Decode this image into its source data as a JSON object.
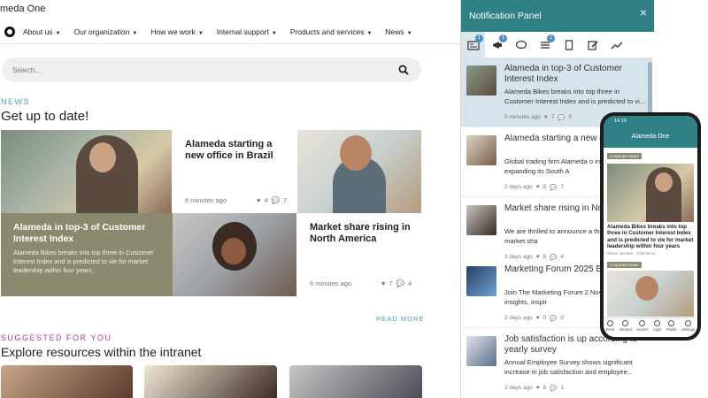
{
  "site": {
    "name": "meda One"
  },
  "nav": {
    "items": [
      "About us",
      "Our organization",
      "How we work",
      "Internal support",
      "Products and services",
      "News"
    ]
  },
  "search": {
    "placeholder": "Search..."
  },
  "news": {
    "eyebrow": "NEWS",
    "title": "Get up to date!",
    "cards": [
      {
        "title": "Alameda starting a new office in Brazil",
        "time": "6 minutes ago",
        "likes": "4",
        "comments": "7"
      },
      {
        "title": "Alameda in top-3 of Customer Interest Index",
        "body": "Alameda Bikes breaks into top three in Customer Interest Index and is predicted to vie for market leadership within four years."
      },
      {
        "title": "Market share rising in North America",
        "time": "6 minutes ago",
        "likes": "7",
        "comments": "4"
      }
    ],
    "read_more": "READ MORE"
  },
  "suggested": {
    "eyebrow": "SUGGESTED FOR YOU",
    "title": "Explore resources within the intranet"
  },
  "panel": {
    "title": "Notification Panel",
    "close": "×",
    "tabs": [
      {
        "icon": "news-icon",
        "badge": "1",
        "active": true
      },
      {
        "icon": "megaphone-icon",
        "badge": "1"
      },
      {
        "icon": "chat-icon"
      },
      {
        "icon": "tasks-icon",
        "badge": "1"
      },
      {
        "icon": "document-icon"
      },
      {
        "icon": "edit-icon"
      },
      {
        "icon": "chart-icon"
      }
    ],
    "items": [
      {
        "title": "Alameda in top-3 of Customer Interest Index",
        "body": "Alameda Bikes breaks into top three in Customer Interest Index and is predicted to vi...",
        "time": "5 minutes ago",
        "likes": "7",
        "comments": "5"
      },
      {
        "title": "Alameda starting a new o Brazil",
        "body": "Global trading firm Alameda o in Brazil, expanding its South A",
        "time": "2 days ago",
        "likes": "5",
        "comments": "7"
      },
      {
        "title": "Market share rising in No",
        "body": "We are thrilled to announce a the North America market sha",
        "time": "3 days ago",
        "likes": "8",
        "comments": "4"
      },
      {
        "title": "Marketing Forum 2025 Berlin",
        "body": "Join The Marketing Forum 2 Nov 12-13 for insights, inspir",
        "time": "2 days ago",
        "likes": "0",
        "comments": "0"
      },
      {
        "title": "Job satisfaction is up according to yearly survey",
        "body": "Annual Employee Survey shows significant increase in job satisfaction and employee...",
        "time": "2 days ago",
        "likes": "6",
        "comments": "1"
      }
    ]
  },
  "phone": {
    "time": "14:16",
    "title": "Alameda One",
    "tag1": "Corporate News",
    "headline": "Alameda Bikes breaks into top three in Customer Interest Index and is predicted to vie for market leadership within four years",
    "meta": "Robert Jenssen · 2025-09-24",
    "tag2": "Corporate News",
    "tabs": [
      "Feed",
      "Intranet",
      "Search",
      "Apps",
      "Profile",
      "Settings"
    ]
  },
  "colors": {
    "teal": "#2f8186",
    "accent_blue": "#4a9fb0",
    "magenta": "#b13b88",
    "olive": "#8b8a6e"
  }
}
